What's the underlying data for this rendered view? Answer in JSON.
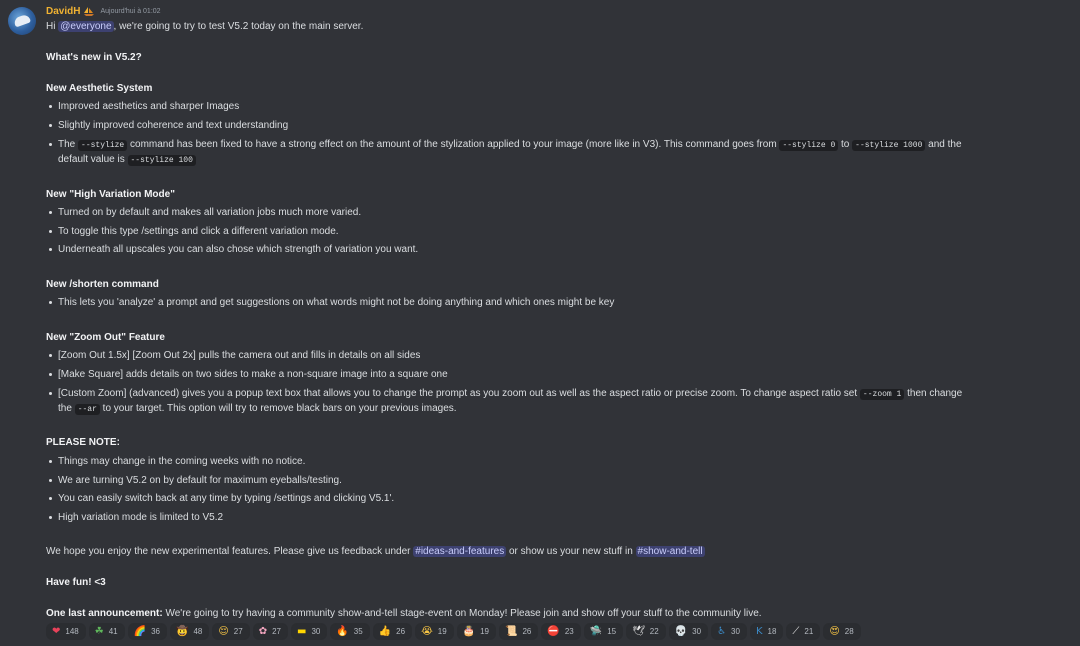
{
  "author": {
    "name": "DavidH",
    "timestamp": "Aujourd'hui à 01:02"
  },
  "intro": {
    "pre": "Hi ",
    "mention": "@everyone",
    "post": ", we're going to try to test V5.2 today on the main server."
  },
  "whats_new": "What's new in V5.2?",
  "aesthetic": {
    "title": "New Aesthetic System",
    "b1": "Improved aesthetics and sharper Images",
    "b2": "Slightly improved coherence and text understanding",
    "b3_pre": "The ",
    "b3_code1": "--stylize",
    "b3_mid": " command has been fixed to have a strong effect on the amount of the stylization applied to your image (more like in V3). This command goes from ",
    "b3_code2": "--stylize 0",
    "b3_to": " to ",
    "b3_code3": "--stylize 1000",
    "b3_post": " and the",
    "b3_line2_pre": "default value is ",
    "b3_code4": "--stylize 100"
  },
  "high_variation": {
    "title": "New \"High Variation Mode\"",
    "b1": "Turned on by default and makes all variation jobs much more varied.",
    "b2": "To toggle this type /settings and click a different variation mode.",
    "b3": "Underneath all upscales you can also chose which strength of variation you want."
  },
  "shorten": {
    "title": "New /shorten command",
    "b1": "This lets you 'analyze' a prompt and get suggestions on what words might not be doing anything and which ones might be key"
  },
  "zoom": {
    "title": "New \"Zoom Out\" Feature",
    "b1": "[Zoom Out 1.5x] [Zoom Out 2x] pulls the camera out and fills in details on all sides",
    "b2": "[Make Square] adds details on two sides to make a non-square image into a square one",
    "b3_pre": "[Custom Zoom] (advanced) gives you a popup text box that allows you to change the prompt as you zoom out as well as the aspect ratio or precise zoom. To change aspect ratio set ",
    "b3_code1": "--zoom 1",
    "b3_post": " then change",
    "b3_line2_pre": "the ",
    "b3_code2": "--ar",
    "b3_line2_post": " to your target. This option will try to remove black bars on your previous images."
  },
  "note": {
    "title": "PLEASE NOTE:",
    "b1": "Things may change in the coming weeks with no notice.",
    "b2": "We are turning V5.2 on by default for maximum eyeballs/testing.",
    "b3": "You can easily switch back at any time by typing /settings and clicking V5.1'.",
    "b4": "High variation mode is limited to V5.2"
  },
  "feedback": {
    "pre": "We hope you enjoy the new experimental features. Please give us feedback under ",
    "channel1": "#ideas-and-features",
    "mid": " or show us your new stuff in ",
    "channel2": "#show-and-tell"
  },
  "have_fun": "Have fun! <3",
  "last": {
    "bold": "One last announcement:",
    "text": " We're going to try having a community show-and-tell stage-event on Monday! Please join and show off your stuff to the community live."
  },
  "reactions": [
    {
      "icon": "heart-emoji",
      "emoji": "❤",
      "color": "#e8425a",
      "count": "148"
    },
    {
      "icon": "clover-emoji",
      "emoji": "☘",
      "color": "#5fb85b",
      "count": "41"
    },
    {
      "icon": "rainbow-emoji",
      "emoji": "🌈",
      "color": "#f0a030",
      "count": "36"
    },
    {
      "icon": "cowboy-face-emoji",
      "emoji": "🤠",
      "color": "#f6c445",
      "count": "48"
    },
    {
      "icon": "face-emoji",
      "emoji": "😌",
      "color": "#f6c445",
      "count": "27"
    },
    {
      "icon": "flower-emoji",
      "emoji": "✿",
      "color": "#f4a6c0",
      "count": "27"
    },
    {
      "icon": "ukraine-flag-emoji",
      "emoji": "▬",
      "color": "#ffd500",
      "count": "30"
    },
    {
      "icon": "fire-emoji",
      "emoji": "🔥",
      "color": "#f57c1f",
      "count": "35"
    },
    {
      "icon": "thumbs-up-emoji",
      "emoji": "👍",
      "color": "#f6c445",
      "count": "26"
    },
    {
      "icon": "crying-face-emoji",
      "emoji": "😭",
      "color": "#f6c445",
      "count": "19"
    },
    {
      "icon": "cake-emoji",
      "emoji": "🎂",
      "color": "#f07ab0",
      "count": "19"
    },
    {
      "icon": "scroll-emoji",
      "emoji": "📜",
      "color": "#e7c592",
      "count": "26"
    },
    {
      "icon": "no-entry-emoji",
      "emoji": "⛔",
      "color": "#e25c4a",
      "count": "23"
    },
    {
      "icon": "ufo-emoji",
      "emoji": "🛸",
      "color": "#c9b14a",
      "count": "15"
    },
    {
      "icon": "bird-emoji",
      "emoji": "🕊",
      "color": "#e6e6e6",
      "count": "22"
    },
    {
      "icon": "skull-emoji",
      "emoji": "💀",
      "color": "#e6e6e6",
      "count": "30"
    },
    {
      "icon": "wheelchair-emoji",
      "emoji": "♿",
      "color": "#3b88c3",
      "count": "30"
    },
    {
      "icon": "k-emoji",
      "emoji": "K",
      "color": "#3b88c3",
      "count": "18"
    },
    {
      "icon": "feather-emoji",
      "emoji": "⟋",
      "color": "#e6e6e6",
      "count": "21"
    },
    {
      "icon": "heart-eyes-emoji",
      "emoji": "😍",
      "color": "#f6c445",
      "count": "28"
    }
  ]
}
